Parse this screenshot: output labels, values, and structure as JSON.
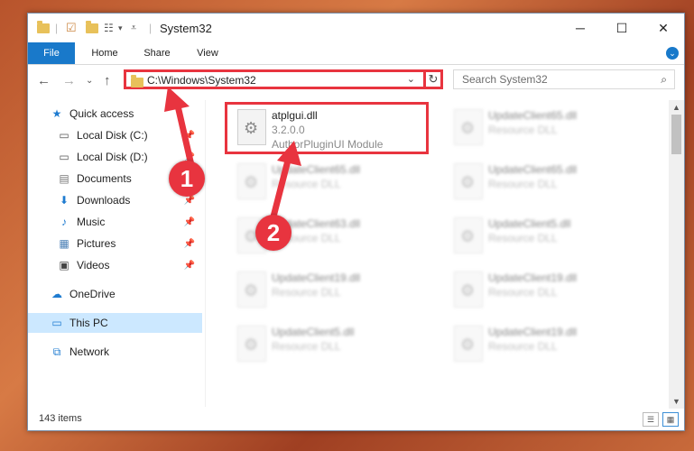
{
  "window": {
    "title": "System32"
  },
  "window_controls": {
    "minimize": "─",
    "maximize": "☐",
    "close": "✕"
  },
  "ribbon": {
    "tabs": [
      {
        "label": "File"
      },
      {
        "label": "Home"
      },
      {
        "label": "Share"
      },
      {
        "label": "View"
      }
    ],
    "expand": "⌄"
  },
  "nav": {
    "back": "←",
    "forward": "→",
    "recent": "⌄",
    "up": "↑",
    "address": "C:\\Windows\\System32",
    "address_dropdown": "⌄",
    "refresh": "↻",
    "search_placeholder": "Search System32",
    "search_icon": "⌕"
  },
  "nav_pane": [
    {
      "label": "Quick access",
      "icon": "star-icon",
      "glyph": "★",
      "pinned": false
    },
    {
      "label": "Local Disk (C:)",
      "icon": "drive-icon",
      "glyph": "▭",
      "pinned": true
    },
    {
      "label": "Local Disk (D:)",
      "icon": "drive-icon",
      "glyph": "▭",
      "pinned": true
    },
    {
      "label": "Documents",
      "icon": "documents-icon",
      "glyph": "▤",
      "pinned": true
    },
    {
      "label": "Downloads",
      "icon": "downloads-icon",
      "glyph": "⬇",
      "pinned": true
    },
    {
      "label": "Music",
      "icon": "music-icon",
      "glyph": "♪",
      "pinned": true
    },
    {
      "label": "Pictures",
      "icon": "pictures-icon",
      "glyph": "▦",
      "pinned": true
    },
    {
      "label": "Videos",
      "icon": "videos-icon",
      "glyph": "▣",
      "pinned": true
    },
    {
      "label": "OneDrive",
      "icon": "cloud-icon",
      "glyph": "☁",
      "pinned": false
    },
    {
      "label": "This PC",
      "icon": "computer-icon",
      "glyph": "▭",
      "pinned": false,
      "selected": true
    },
    {
      "label": "Network",
      "icon": "network-icon",
      "glyph": "⧉",
      "pinned": false
    }
  ],
  "pin_glyph": "📌",
  "files": [
    {
      "name": "atplgui.dll",
      "line1": "3.2.0.0",
      "line2": "AuthorPluginUI Module",
      "highlighted": true
    },
    {
      "name": "UpdateClient65.dll",
      "line1": "Resource DLL",
      "line2": ""
    },
    {
      "name": "UpdateClient65.dll",
      "line1": "Resource DLL",
      "line2": ""
    },
    {
      "name": "UpdateClient65.dll",
      "line1": "Resource DLL",
      "line2": ""
    },
    {
      "name": "UpdateClient63.dll",
      "line1": "Resource DLL",
      "line2": ""
    },
    {
      "name": "UpdateClient5.dll",
      "line1": "Resource DLL",
      "line2": ""
    },
    {
      "name": "UpdateClient19.dll",
      "line1": "Resource DLL",
      "line2": ""
    },
    {
      "name": "UpdateClient19.dll",
      "line1": "Resource DLL",
      "line2": ""
    },
    {
      "name": "UpdateClient5.dll",
      "line1": "Resource DLL",
      "line2": ""
    },
    {
      "name": "UpdateClient19.dll",
      "line1": "Resource DLL",
      "line2": ""
    }
  ],
  "scrollbar": {
    "up": "▲",
    "down": "▼"
  },
  "status": {
    "item_count": "143 items",
    "details_view": "☰",
    "icons_view": "▦"
  },
  "annotations": [
    "1",
    "2"
  ],
  "colors": {
    "accent": "#1979ca",
    "highlight": "#e8343f",
    "selected": "#cce8ff"
  }
}
